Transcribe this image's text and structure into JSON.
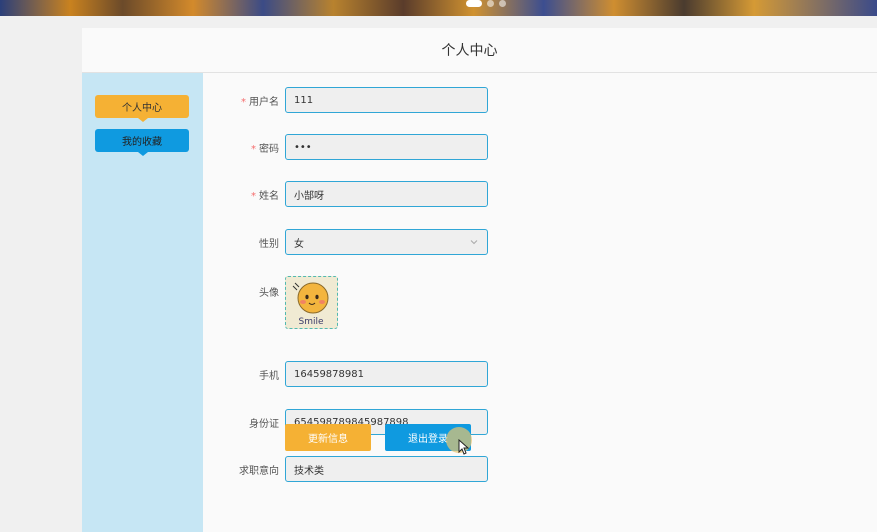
{
  "header": {
    "title": "个人中心"
  },
  "sidebar": {
    "items": [
      {
        "label": "个人中心",
        "color": "#f5b134"
      },
      {
        "label": "我的收藏",
        "color": "#0f9ae0"
      }
    ]
  },
  "form": {
    "username": {
      "label": "用户名",
      "required": "*",
      "value": "111"
    },
    "password": {
      "label": "密码",
      "required": "*",
      "value": "•••"
    },
    "name": {
      "label": "姓名",
      "required": "*",
      "value": "小郜呀"
    },
    "gender": {
      "label": "性别",
      "value": "女"
    },
    "avatar": {
      "label": "头像",
      "image_text": "Smile"
    },
    "phone": {
      "label": "手机",
      "value": "16459878981"
    },
    "id_card": {
      "label": "身份证",
      "value": "654598789845987898"
    },
    "job_intent": {
      "label": "求职意向",
      "value": "技术类"
    }
  },
  "buttons": {
    "update": "更新信息",
    "logout": "退出登录"
  },
  "colors": {
    "accent_orange": "#f5b134",
    "accent_blue": "#0f9ae0",
    "sidebar_bg": "#c6e6f4",
    "input_border": "#30a6d6",
    "required_star": "#f56c6c"
  }
}
